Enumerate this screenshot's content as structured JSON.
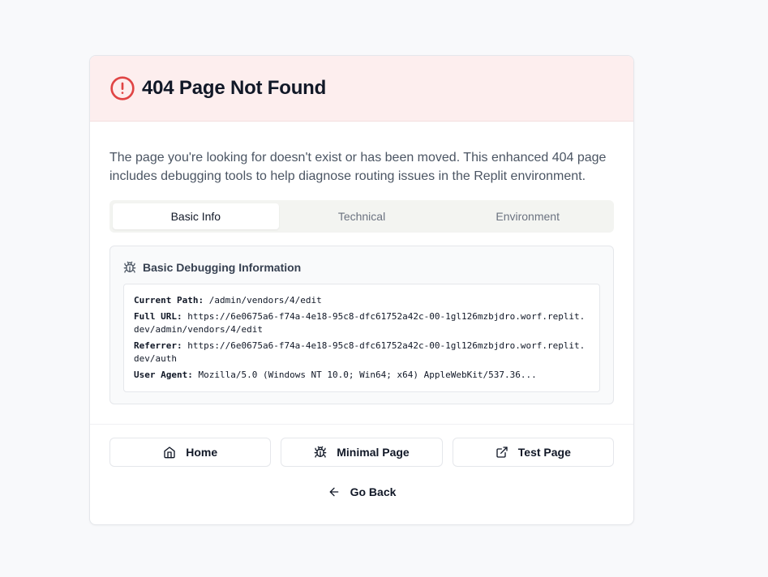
{
  "header": {
    "title": "404 Page Not Found",
    "icon": "alert-circle-icon",
    "accent_color": "#e04444"
  },
  "description": "The page you're looking for doesn't exist or has been moved. This enhanced 404 page includes debugging tools to help diagnose routing issues in the Replit environment.",
  "tabs": [
    {
      "label": "Basic Info",
      "active": true
    },
    {
      "label": "Technical",
      "active": false
    },
    {
      "label": "Environment",
      "active": false
    }
  ],
  "debug": {
    "title": "Basic Debugging Information",
    "icon": "bug-icon",
    "rows": [
      {
        "key": "Current Path:",
        "value": "/admin/vendors/4/edit"
      },
      {
        "key": "Full URL:",
        "value": "https://6e0675a6-f74a-4e18-95c8-dfc61752a42c-00-1gl126mzbjdro.worf.replit.dev/admin/vendors/4/edit"
      },
      {
        "key": "Referrer:",
        "value": "https://6e0675a6-f74a-4e18-95c8-dfc61752a42c-00-1gl126mzbjdro.worf.replit.dev/auth"
      },
      {
        "key": "User Agent:",
        "value": "Mozilla/5.0 (Windows NT 10.0; Win64; x64) AppleWebKit/537.36..."
      }
    ]
  },
  "actions": {
    "home": "Home",
    "minimal": "Minimal Page",
    "test": "Test Page",
    "back": "Go Back"
  }
}
